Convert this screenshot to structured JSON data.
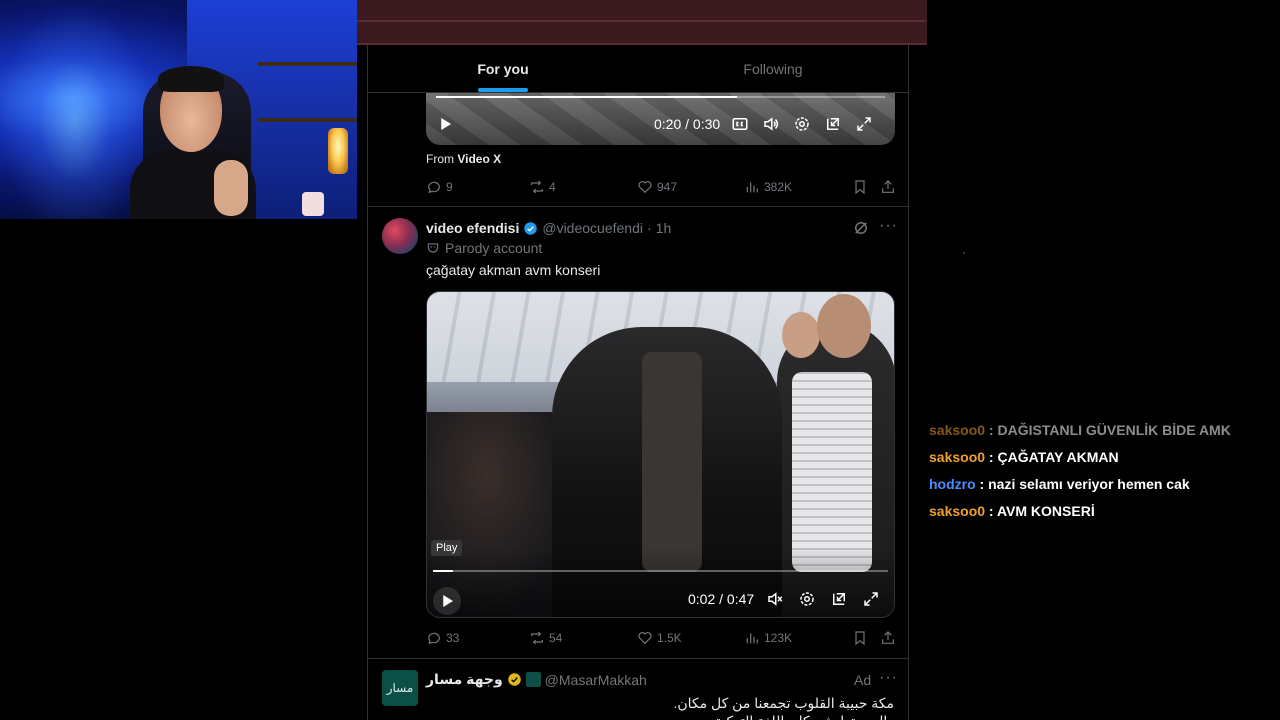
{
  "feed": {
    "tabs": [
      {
        "label": "For you",
        "active": true
      },
      {
        "label": "Following",
        "active": false
      }
    ],
    "tweets": [
      {
        "video": {
          "time": "0:20 / 0:30",
          "progress": 0.67
        },
        "from_prefix": "From",
        "from_source": "Video X",
        "stats": {
          "replies": "9",
          "reposts": "4",
          "likes": "947",
          "views": "382K"
        }
      },
      {
        "display_name": "video efendisi",
        "handle": "@videocuefendi",
        "separator": "·",
        "time": "1h",
        "label": "Parody account",
        "text": "çağatay akman avm konseri",
        "video": {
          "time": "0:02 / 0:47",
          "progress": 0.045,
          "tooltip": "Play"
        },
        "stats": {
          "replies": "33",
          "reposts": "54",
          "likes": "1.5K",
          "views": "123K"
        }
      },
      {
        "display_name": "وجهة مسار",
        "handle": "@MasarMakkah",
        "ad_label": "Ad",
        "avatar_text": "مسار",
        "text_lines": [
          "مكة حبيبة القلوب تجمعنا من كل مكان.",
          "والبيد بتعايش بكل باللغة التركية"
        ]
      }
    ]
  },
  "chat": {
    "messages": [
      {
        "user": "saksoo0",
        "user_color": "#f0a030",
        "text": "DAĞISTANLI GÜVENLİK BİDE AMK",
        "faded": true
      },
      {
        "user": "saksoo0",
        "user_color": "#f0a030",
        "text": "ÇAĞATAY AKMAN",
        "faded": false
      },
      {
        "user": "hodzro",
        "user_color": "#4a8cff",
        "text": "nazi selamı veriyor hemen cak",
        "faded": false
      },
      {
        "user": "saksoo0",
        "user_color": "#f0a030",
        "text": "AVM KONSERİ",
        "faded": false
      }
    ],
    "separator": " : "
  },
  "colors": {
    "accent": "#1d9bf0",
    "verified": "#1d9bf0",
    "gold_verified": "#e2b719",
    "muted": "#71767b"
  }
}
